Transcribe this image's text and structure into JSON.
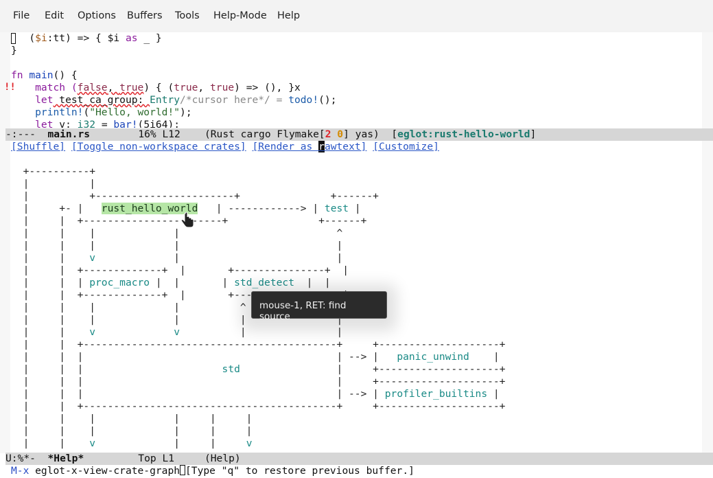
{
  "menubar": {
    "items": [
      "File",
      "Edit",
      "Options",
      "Buffers",
      "Tools",
      "Help-Mode",
      "Help"
    ]
  },
  "code": {
    "line1_a": "   (",
    "line1_var": "$i",
    "line1_b": ":tt) => { $i ",
    "line1_kw": "as",
    "line1_c": " _ }",
    "line2": "}",
    "line3": "",
    "line4_kw": "fn",
    "line4_fn": "main",
    "line4_rest": "() {",
    "line5_a": "    match (",
    "line5_f": "false",
    "line5_b": ", ",
    "line5_t": "true",
    "line5_c": ") { (",
    "line5_t2": "true",
    "line5_d": ", ",
    "line5_t3": "true",
    "line5_e": ") => (), }x",
    "line6_kw": "    let",
    "line6_a": " test_ca_group: ",
    "line6_ty": "Entry",
    "line6_b": "/*cursor here*/ = ",
    "line6_mac": "todo!",
    "line6_c": "();",
    "line7_mac": "    println!",
    "line7_a": "(",
    "line7_str": "\"Hello, world!\"",
    "line7_b": ");",
    "line8_kw": "    let",
    "line8_a": " v: ",
    "line8_ty": "i32",
    "line8_b": " = ",
    "line8_fn": "bar!",
    "line8_c": "(5i64);"
  },
  "error_marker": "!!",
  "modeline_top": {
    "status": "-:---  ",
    "buffer": "main.rs",
    "position": "        16% L12    ",
    "modes_a": "(Rust cargo Flymake[",
    "err_count": "2",
    "warn_count": "0",
    "modes_b": "] yas)  [",
    "eglot_label": "eglot:",
    "eglot_project": "rust-hello-world",
    "eglot_end": "]"
  },
  "help_links": {
    "shuffle": "[Shuffle]",
    "toggle": "[Toggle non-workspace crates]",
    "render_a": "[Render as ",
    "render_cursor": "r",
    "render_b": "awtext]",
    "customize": "[Customize]"
  },
  "graph": {
    "nodes": {
      "rust_hello_world": "rust_hello_world",
      "test": "test",
      "proc_macro": "proc_macro",
      "std_detect": "std_detect",
      "std": "std",
      "panic_unwind": "panic_unwind",
      "profiler_builtins": "profiler_builtins"
    }
  },
  "tooltip": "mouse-1, RET: find source",
  "modeline_bottom": {
    "status": "U:%*-  ",
    "buffer": "*Help*",
    "position": "         Top L1     ",
    "mode": "(Help)"
  },
  "echo": {
    "prompt": "M-x",
    "command": " eglot-x-view-crate-graph",
    "message": "[Type \"q\" to restore previous buffer.]"
  }
}
